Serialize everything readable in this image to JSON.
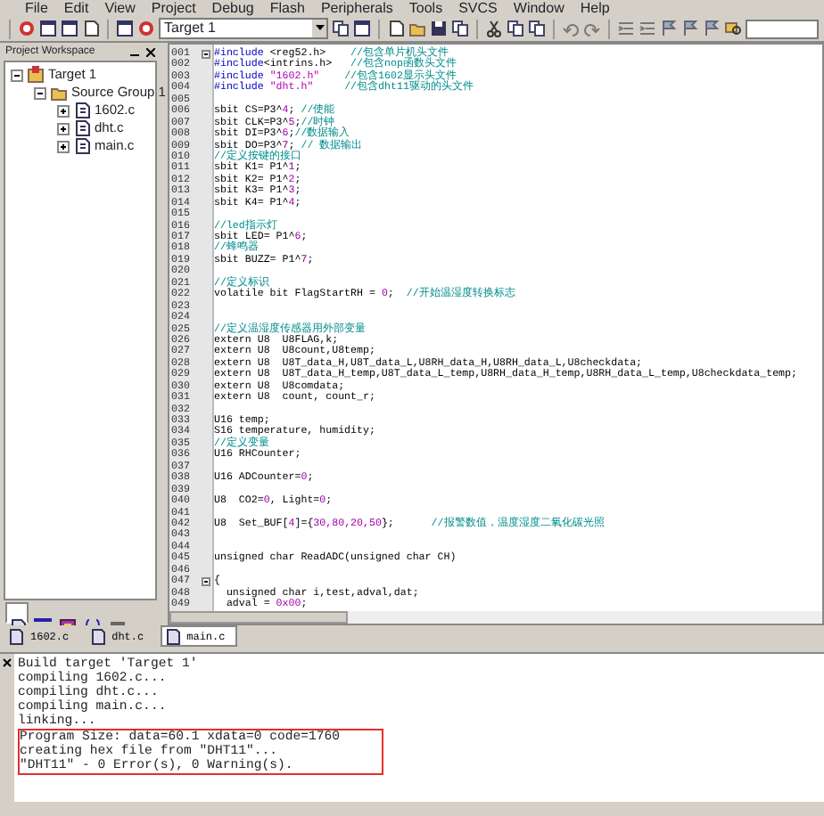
{
  "menu": [
    "File",
    "Edit",
    "View",
    "Project",
    "Debug",
    "Flash",
    "Peripherals",
    "Tools",
    "SVCS",
    "Window",
    "Help"
  ],
  "toolbar": {
    "target": "Target 1"
  },
  "workspace": {
    "title": "Project Workspace",
    "tree": [
      {
        "label": "Target 1",
        "kind": "target",
        "expanded": true,
        "children": [
          {
            "label": "Source Group 1",
            "kind": "folder",
            "expanded": true,
            "children": [
              {
                "label": "1602.c",
                "kind": "file",
                "expanded": false
              },
              {
                "label": "dht.c",
                "kind": "file",
                "expanded": false
              },
              {
                "label": "main.c",
                "kind": "file",
                "expanded": false
              }
            ]
          }
        ]
      }
    ],
    "tabs": [
      {
        "kind": "files",
        "selected": true
      },
      {
        "kind": "regs",
        "selected": false
      },
      {
        "kind": "books",
        "selected": false
      },
      {
        "kind": "functions",
        "selected": false
      },
      {
        "kind": "templates",
        "selected": false
      }
    ]
  },
  "editor": {
    "lines": [
      {
        "no": "001",
        "fold": true,
        "parts": [
          {
            "kind": "keyword",
            "text": "#include"
          },
          {
            "kind": "code",
            "text": " <reg52.h>    "
          },
          {
            "kind": "comment",
            "text": "//包含单片机头文件"
          }
        ]
      },
      {
        "no": "002",
        "fold": false,
        "parts": [
          {
            "kind": "keyword",
            "text": "#include"
          },
          {
            "kind": "code",
            "text": "<intrins.h>   "
          },
          {
            "kind": "comment",
            "text": "//包含nop函数头文件"
          }
        ]
      },
      {
        "no": "003",
        "fold": false,
        "parts": [
          {
            "kind": "keyword",
            "text": "#include"
          },
          {
            "kind": "string",
            "text": " \"1602.h\"    "
          },
          {
            "kind": "comment",
            "text": "//包含1602显示头文件"
          }
        ]
      },
      {
        "no": "004",
        "fold": false,
        "parts": [
          {
            "kind": "keyword",
            "text": "#include"
          },
          {
            "kind": "string",
            "text": " \"dht.h\"     "
          },
          {
            "kind": "comment",
            "text": "//包含dht11驱动的头文件"
          }
        ]
      },
      {
        "no": "005",
        "fold": false
      },
      {
        "no": "006",
        "fold": false,
        "parts": [
          {
            "kind": "code",
            "text": "sbit CS=P3^"
          },
          {
            "kind": "number",
            "text": "4"
          },
          {
            "kind": "code",
            "text": "; "
          },
          {
            "kind": "comment",
            "text": "//使能"
          }
        ]
      },
      {
        "no": "007",
        "fold": false,
        "parts": [
          {
            "kind": "code",
            "text": "sbit CLK=P3^"
          },
          {
            "kind": "number",
            "text": "5"
          },
          {
            "kind": "code",
            "text": ";"
          },
          {
            "kind": "comment",
            "text": "//时钟"
          }
        ]
      },
      {
        "no": "008",
        "fold": false,
        "parts": [
          {
            "kind": "code",
            "text": "sbit DI=P3^"
          },
          {
            "kind": "number",
            "text": "6"
          },
          {
            "kind": "code",
            "text": ";"
          },
          {
            "kind": "comment",
            "text": "//数据输入"
          }
        ]
      },
      {
        "no": "009",
        "fold": false,
        "parts": [
          {
            "kind": "code",
            "text": "sbit DO=P3^"
          },
          {
            "kind": "number",
            "text": "7"
          },
          {
            "kind": "code",
            "text": "; "
          },
          {
            "kind": "comment",
            "text": "// 数据输出"
          }
        ]
      },
      {
        "no": "010",
        "fold": false,
        "parts": [
          {
            "kind": "comment",
            "text": "//定义按键的接口"
          }
        ]
      },
      {
        "no": "011",
        "fold": false,
        "parts": [
          {
            "kind": "code",
            "text": "sbit K1= P1^"
          },
          {
            "kind": "number",
            "text": "1"
          },
          {
            "kind": "code",
            "text": ";"
          }
        ]
      },
      {
        "no": "012",
        "fold": false,
        "parts": [
          {
            "kind": "code",
            "text": "sbit K2= P1^"
          },
          {
            "kind": "number",
            "text": "2"
          },
          {
            "kind": "code",
            "text": ";"
          }
        ]
      },
      {
        "no": "013",
        "fold": false,
        "parts": [
          {
            "kind": "code",
            "text": "sbit K3= P1^"
          },
          {
            "kind": "number",
            "text": "3"
          },
          {
            "kind": "code",
            "text": ";"
          }
        ]
      },
      {
        "no": "014",
        "fold": false,
        "parts": [
          {
            "kind": "code",
            "text": "sbit K4= P1^"
          },
          {
            "kind": "number",
            "text": "4"
          },
          {
            "kind": "code",
            "text": ";"
          }
        ]
      },
      {
        "no": "015",
        "fold": false
      },
      {
        "no": "016",
        "fold": false,
        "parts": [
          {
            "kind": "comment",
            "text": "//led指示灯"
          }
        ]
      },
      {
        "no": "017",
        "fold": false,
        "parts": [
          {
            "kind": "code",
            "text": "sbit LED= P1^"
          },
          {
            "kind": "number",
            "text": "6"
          },
          {
            "kind": "code",
            "text": ";"
          }
        ]
      },
      {
        "no": "018",
        "fold": false,
        "parts": [
          {
            "kind": "comment",
            "text": "//蜂鸣器"
          }
        ]
      },
      {
        "no": "019",
        "fold": false,
        "parts": [
          {
            "kind": "code",
            "text": "sbit BUZZ= P1^"
          },
          {
            "kind": "number",
            "text": "7"
          },
          {
            "kind": "code",
            "text": ";"
          }
        ]
      },
      {
        "no": "020",
        "fold": false
      },
      {
        "no": "021",
        "fold": false,
        "parts": [
          {
            "kind": "comment",
            "text": "//定义标识"
          }
        ]
      },
      {
        "no": "022",
        "fold": false,
        "parts": [
          {
            "kind": "code",
            "text": "volatile bit FlagStartRH = "
          },
          {
            "kind": "number",
            "text": "0"
          },
          {
            "kind": "code",
            "text": ";  "
          },
          {
            "kind": "comment",
            "text": "//开始温湿度转换标志"
          }
        ]
      },
      {
        "no": "023",
        "fold": false
      },
      {
        "no": "024",
        "fold": false
      },
      {
        "no": "025",
        "fold": false,
        "parts": [
          {
            "kind": "comment",
            "text": "//定义温湿度传感器用外部变量"
          }
        ]
      },
      {
        "no": "026",
        "fold": false,
        "parts": [
          {
            "kind": "code",
            "text": "extern U8  U8FLAG,k;"
          }
        ]
      },
      {
        "no": "027",
        "fold": false,
        "parts": [
          {
            "kind": "code",
            "text": "extern U8  U8count,U8temp;"
          }
        ]
      },
      {
        "no": "028",
        "fold": false,
        "parts": [
          {
            "kind": "code",
            "text": "extern U8  U8T_data_H,U8T_data_L,U8RH_data_H,U8RH_data_L,U8checkdata;"
          }
        ]
      },
      {
        "no": "029",
        "fold": false,
        "parts": [
          {
            "kind": "code",
            "text": "extern U8  U8T_data_H_temp,U8T_data_L_temp,U8RH_data_H_temp,U8RH_data_L_temp,U8checkdata_temp;"
          }
        ]
      },
      {
        "no": "030",
        "fold": false,
        "parts": [
          {
            "kind": "code",
            "text": "extern U8  U8comdata;"
          }
        ]
      },
      {
        "no": "031",
        "fold": false,
        "parts": [
          {
            "kind": "code",
            "text": "extern U8  count, count_r;"
          }
        ]
      },
      {
        "no": "032",
        "fold": false
      },
      {
        "no": "033",
        "fold": false,
        "parts": [
          {
            "kind": "code",
            "text": "U16 temp;"
          }
        ]
      },
      {
        "no": "034",
        "fold": false,
        "parts": [
          {
            "kind": "code",
            "text": "S16 temperature, humidity;"
          }
        ]
      },
      {
        "no": "035",
        "fold": false,
        "parts": [
          {
            "kind": "comment",
            "text": "//定义变量"
          }
        ]
      },
      {
        "no": "036",
        "fold": false,
        "parts": [
          {
            "kind": "code",
            "text": "U16 RHCounter;"
          }
        ]
      },
      {
        "no": "037",
        "fold": false
      },
      {
        "no": "038",
        "fold": false,
        "parts": [
          {
            "kind": "code",
            "text": "U16 ADCounter="
          },
          {
            "kind": "number",
            "text": "0"
          },
          {
            "kind": "code",
            "text": ";"
          }
        ]
      },
      {
        "no": "039",
        "fold": false
      },
      {
        "no": "040",
        "fold": false,
        "parts": [
          {
            "kind": "code",
            "text": "U8  CO2="
          },
          {
            "kind": "number",
            "text": "0"
          },
          {
            "kind": "code",
            "text": ", Light="
          },
          {
            "kind": "number",
            "text": "0"
          },
          {
            "kind": "code",
            "text": ";"
          }
        ]
      },
      {
        "no": "041",
        "fold": false
      },
      {
        "no": "042",
        "fold": false,
        "parts": [
          {
            "kind": "code",
            "text": "U8  Set_BUF["
          },
          {
            "kind": "number",
            "text": "4"
          },
          {
            "kind": "code",
            "text": "]={"
          },
          {
            "kind": "number",
            "text": "30,80,20,50"
          },
          {
            "kind": "code",
            "text": "};      "
          },
          {
            "kind": "comment",
            "text": "//报警数值，温度湿度二氧化碳光照"
          }
        ]
      },
      {
        "no": "043",
        "fold": false
      },
      {
        "no": "044",
        "fold": false
      },
      {
        "no": "045",
        "fold": false,
        "parts": [
          {
            "kind": "code",
            "text": "unsigned char ReadADC(unsigned char CH)"
          }
        ]
      },
      {
        "no": "046",
        "fold": false
      },
      {
        "no": "047",
        "fold": true,
        "parts": [
          {
            "kind": "code",
            "text": "{"
          }
        ]
      },
      {
        "no": "048",
        "fold": false,
        "parts": [
          {
            "kind": "code",
            "text": "  unsigned char i,test,adval,dat;"
          }
        ]
      },
      {
        "no": "049",
        "fold": false,
        "parts": [
          {
            "kind": "code",
            "text": "  adval = "
          },
          {
            "kind": "number",
            "text": "0x00"
          },
          {
            "kind": "code",
            "text": ";"
          }
        ]
      }
    ],
    "tabs": [
      {
        "label": "1602.c",
        "selected": false
      },
      {
        "label": "dht.c",
        "selected": false
      },
      {
        "label": "main.c",
        "selected": true
      }
    ]
  },
  "output": {
    "lines": [
      {
        "text": "Build target 'Target 1'",
        "highlighted": false
      },
      {
        "text": "compiling 1602.c...",
        "highlighted": false
      },
      {
        "text": "compiling dht.c...",
        "highlighted": false
      },
      {
        "text": "compiling main.c...",
        "highlighted": false
      },
      {
        "text": "linking...",
        "highlighted": false
      },
      {
        "text": "Program Size: data=60.1 xdata=0 code=1760",
        "highlighted": true
      },
      {
        "text": "creating hex file from \"DHT11\"...",
        "highlighted": true
      },
      {
        "text": "\"DHT11\" - 0 Error(s), 0 Warning(s).",
        "highlighted": true
      }
    ]
  }
}
